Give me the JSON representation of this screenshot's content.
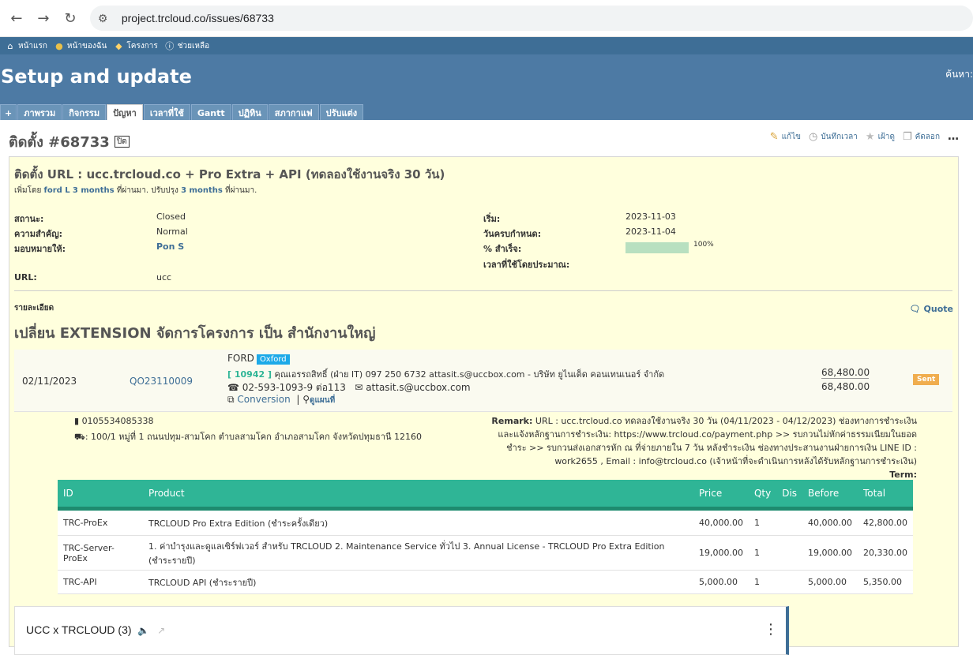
{
  "browser": {
    "url": "project.trcloud.co/issues/68733"
  },
  "topmenu": {
    "items": [
      "หน้าแรก",
      "หน้าของฉัน",
      "โครงการ",
      "ช่วยเหลือ"
    ]
  },
  "header": {
    "title": "Setup and update",
    "search_label": "ค้นหา:"
  },
  "tabs": [
    "+",
    "ภาพรวม",
    "กิจกรรม",
    "ปัญหา",
    "เวลาที่ใช้",
    "Gantt",
    "ปฏิทิน",
    "สภากาแฟ",
    "ปรับแต่ง"
  ],
  "issue": {
    "title": "ติดตั้ง #68733",
    "closed_badge": "ปิด",
    "actions": [
      "แก้ไข",
      "บันทึกเวลา",
      "เฝ้าดู",
      "คัดลอก"
    ],
    "subject": "ติดตั้ง URL : ucc.trcloud.co + Pro Extra + API (ทดลองใช้งานจริง 30 วัน)",
    "author_prefix": "เพิ่มโดย",
    "author_name": "ford L",
    "author_time": "3 months",
    "author_mid": "ที่ผ่านมา. ปรับปรุง",
    "updated_time": "3 months",
    "author_suffix": "ที่ผ่านมา.",
    "attrs": {
      "status_label": "สถานะ:",
      "status": "Closed",
      "priority_label": "ความสำคัญ:",
      "priority": "Normal",
      "assignee_label": "มอบหมายให้:",
      "assignee": "Pon S",
      "url_label": "URL:",
      "url": "ucc",
      "start_label": "เริ่ม:",
      "start": "2023-11-03",
      "due_label": "วันครบกำหนด:",
      "due": "2023-11-04",
      "done_label": "% สำเร็จ:",
      "done": "100%",
      "done_fraction": 1.0,
      "estimate_label": "เวลาที่ใช้โดยประมาณ:"
    },
    "description_label": "รายละเอียด",
    "quote_label": "Quote",
    "description_title": "เปลี่ยน EXTENSION จัดการโครงการ เป็น สำนักงานใหญ่"
  },
  "quotation": {
    "date": "02/11/2023",
    "number": "QO23110009",
    "customer": "FORD",
    "tag": "Oxford",
    "contact_code": "[ 10942 ]",
    "contact": "คุณเอรรถสิทธิ์ (ฝ่าย IT) 097 250 6732 attasit.s@uccbox.com - บริษัท ยูไนเต็ด คอนเทนเนอร์ จำกัด",
    "phone": "02-593-1093-9 ต่อ113",
    "email": "attasit.s@uccbox.com",
    "conversion": "Conversion",
    "view_map": "ดูแผนที่",
    "amount_top": "68,480.00",
    "amount_bottom": "68,480.00",
    "status": "Sent",
    "tax_id": "0105534085338",
    "address": ": 100/1 หมู่ที่ 1 ถนนปทุม-สามโคก ตำบลสามโคก อำเภอสามโคก จังหวัดปทุมธานี 12160",
    "remark_label": "Remark:",
    "remark": "URL : ucc.trcloud.co ทดลองใช้งานจริง 30 วัน (04/11/2023 - 04/12/2023) ช่องทางการชำระเงินและแจ้งหลักฐานการชำระเงิน: https://www.trcloud.co/payment.php >> รบกวนไม่หักค่าธรรมเนียมในยอดชำระ >> รบกวนส่งเอกสารหัก ณ ที่จ่ายภายใน 7 วัน หลังชำระเงิน ช่องทางประสานงานฝ่ายการเงิน LINE ID : work2655 , Email : info@trcloud.co (เจ้าหน้าที่จะดำเนินการหลังได้รับหลักฐานการชำระเงิน)",
    "term_label": "Term:"
  },
  "products": {
    "headers": [
      "ID",
      "Product",
      "Price",
      "Qty",
      "Dis",
      "Before",
      "Total"
    ],
    "rows": [
      [
        "TRC-ProEx",
        "TRCLOUD Pro Extra Edition (ชำระครั้งเดียว)",
        "40,000.00",
        "1",
        "",
        "40,000.00",
        "42,800.00"
      ],
      [
        "TRC-Server-ProEx",
        "1. ค่าบำรุงและดูแลเซิร์ฟเวอร์ สำหรับ TRCLOUD 2. Maintenance Service ทั่วไป 3. Annual License - TRCLOUD Pro Extra Edition (ชำระรายปี)",
        "19,000.00",
        "1",
        "",
        "19,000.00",
        "20,330.00"
      ],
      [
        "TRC-API",
        "TRCLOUD API (ชำระรายปี)",
        "5,000.00",
        "1",
        "",
        "5,000.00",
        "5,350.00"
      ]
    ]
  },
  "chat": {
    "title": "UCC x TRCLOUD (3)"
  }
}
